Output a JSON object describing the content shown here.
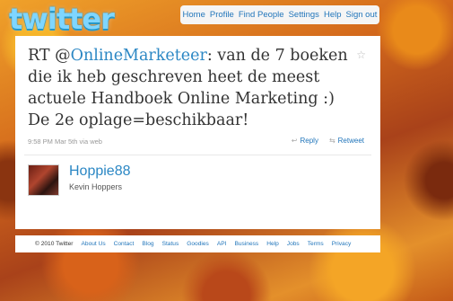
{
  "brand": {
    "logo_text": "twitter",
    "link_color": "#2276bb",
    "mention_color": "#2b87c4"
  },
  "nav": {
    "items": [
      "Home",
      "Profile",
      "Find People",
      "Settings",
      "Help",
      "Sign out"
    ]
  },
  "tweet": {
    "prefix": "RT @",
    "mention": "OnlineMarketeer",
    "body": ": van de 7 boeken die ik heb geschreven heet de meest actuele Handboek Online Marketing :) De 2e oplage=beschikbaar!",
    "timestamp": "9:58 PM Mar 5th via web",
    "reply_label": "Reply",
    "retweet_label": "Retweet",
    "star_icon": "star-icon"
  },
  "user": {
    "screen_name": "Hoppie88",
    "full_name": "Kevin Hoppers"
  },
  "footer": {
    "copyright": "© 2010 Twitter",
    "links": [
      "About Us",
      "Contact",
      "Blog",
      "Status",
      "Goodies",
      "API",
      "Business",
      "Help",
      "Jobs",
      "Terms",
      "Privacy"
    ]
  }
}
